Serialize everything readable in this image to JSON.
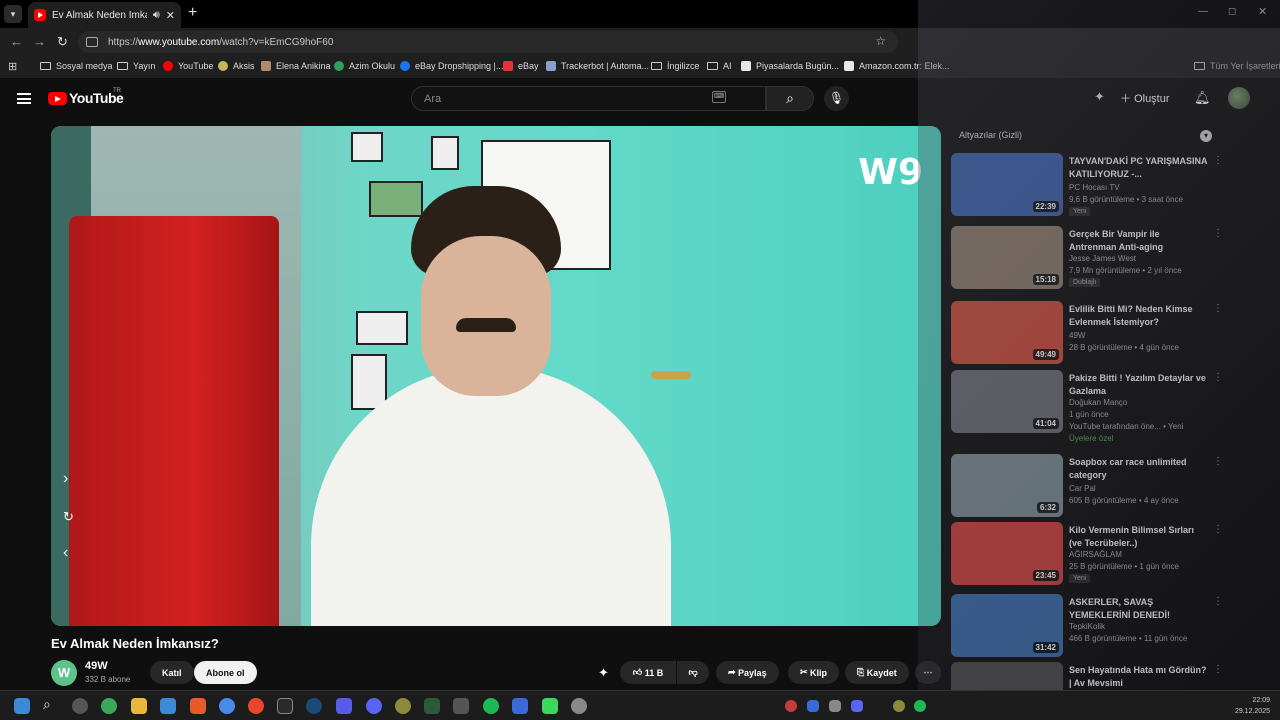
{
  "browser": {
    "tab_title": "Ev Almak Neden İmkansız?",
    "new_tab": "+",
    "url_scheme": "https://",
    "url_host": "www.youtube.com",
    "url_path": "/watch?v=kEmCG9hoF60",
    "bookmarks": [
      {
        "label": "Sosyal medya",
        "kind": "folder"
      },
      {
        "label": "Yayın",
        "kind": "folder"
      },
      {
        "label": "YouTube",
        "kind": "site",
        "color": "#ff0000"
      },
      {
        "label": "Aksis",
        "kind": "site",
        "color": "#c8b45a"
      },
      {
        "label": "Elena Anikina",
        "kind": "site",
        "color": "#b08a6a"
      },
      {
        "label": "Azim Okulu",
        "kind": "site",
        "color": "#2ea05a"
      },
      {
        "label": "eBay Dropshipping |...",
        "kind": "site",
        "color": "#1877f2"
      },
      {
        "label": "eBay",
        "kind": "site",
        "color": "#e53238"
      },
      {
        "label": "Trackerbot | Automa...",
        "kind": "site",
        "color": "#8aa0c8"
      },
      {
        "label": "İngilizce",
        "kind": "folder"
      },
      {
        "label": "AI",
        "kind": "folder"
      },
      {
        "label": "Piyasalarda Bugün...",
        "kind": "site",
        "color": "#e8e8e8"
      },
      {
        "label": "Amazon.com.tr: Elek...",
        "kind": "site",
        "color": "#e8e8e8"
      }
    ],
    "all_bookmarks": "Tüm Yer İşaretleri"
  },
  "youtube": {
    "logo_text": "YouTube",
    "logo_region": "TR",
    "search_placeholder": "Ara",
    "create_label": "Oluştur",
    "video": {
      "title": "Ev Almak Neden İmkansız?",
      "channel": "49W",
      "channel_initial": "W",
      "subscribers": "332 B abone",
      "join": "Katıl",
      "subscribe": "Abone ol",
      "likes": "11 B",
      "share": "Paylaş",
      "clip": "Klip",
      "save": "Kaydet",
      "watermark": "W9"
    },
    "sidebar_header": "Altyazılar (Gizli)",
    "recommendations": [
      {
        "title": "TAYVAN'DAKİ PC YARIŞMASINA KATILIYORUZ -...",
        "channel": "PC Hocası TV",
        "meta": "9,6 B görüntüleme • 3 saat önce",
        "badge": "Yeni",
        "duration": "22:39",
        "thumb_color": "#3a5fa8"
      },
      {
        "title": "Gerçek Bir Vampir ile Antrenman Anti-aging",
        "channel": "Jesse James West",
        "meta": "7,9 Mn görüntüleme • 2 yıl önce",
        "badge": "Dublajlı",
        "duration": "15:18",
        "thumb_color": "#8a7a6a"
      },
      {
        "title": "Evlilik Bitti Mi? Neden Kimse Evlenmek İstemiyor?",
        "channel": "49W",
        "meta": "28 B görüntüleme • 4 gün önce",
        "badge": "",
        "duration": "49:49",
        "thumb_color": "#c84a3a"
      },
      {
        "title": "Pakize Bitti ! Yazılım Detaylar ve Gazlama",
        "channel": "Doğukan Manço",
        "meta": "1 gün önce",
        "badge": "YouTube tarafından öne... • Yeni",
        "extra": "Üyelere özel",
        "duration": "41:04",
        "thumb_color": "#6a6a72"
      },
      {
        "title": "Soapbox car race unlimited category",
        "channel": "Car Pal",
        "meta": "605 B görüntüleme • 4 ay önce",
        "badge": "",
        "duration": "6:32",
        "thumb_color": "#7a8a90"
      },
      {
        "title": "Kilo Vermenin Bilimsel Sırları (ve Tecrübeler..)",
        "channel": "AĞIRSAĞLAM",
        "meta": "25 B görüntüleme • 1 gün önce",
        "badge": "Yeni",
        "duration": "23:45",
        "thumb_color": "#c8403a"
      },
      {
        "title": "ASKERLER, SAVAŞ YEMEKLERİNİ DENEDİ!",
        "channel": "TepkiKolik",
        "meta": "466 B görüntüleme • 11 gün önce",
        "badge": "",
        "duration": "31:42",
        "thumb_color": "#3a6aa8"
      },
      {
        "title": "Sen Hayatında Hata mı Gördün? | Av Mevsimi",
        "channel": "",
        "meta": "",
        "badge": "",
        "duration": "",
        "thumb_color": "#4a4a4a"
      }
    ]
  },
  "taskbar": {
    "clock_time": "22:09",
    "clock_date": "29.12.2025"
  },
  "colors": {
    "background": "#0f0f0f",
    "yt_red": "#ff0000",
    "text": "#f1f1f1",
    "muted": "#aaaaaa"
  }
}
